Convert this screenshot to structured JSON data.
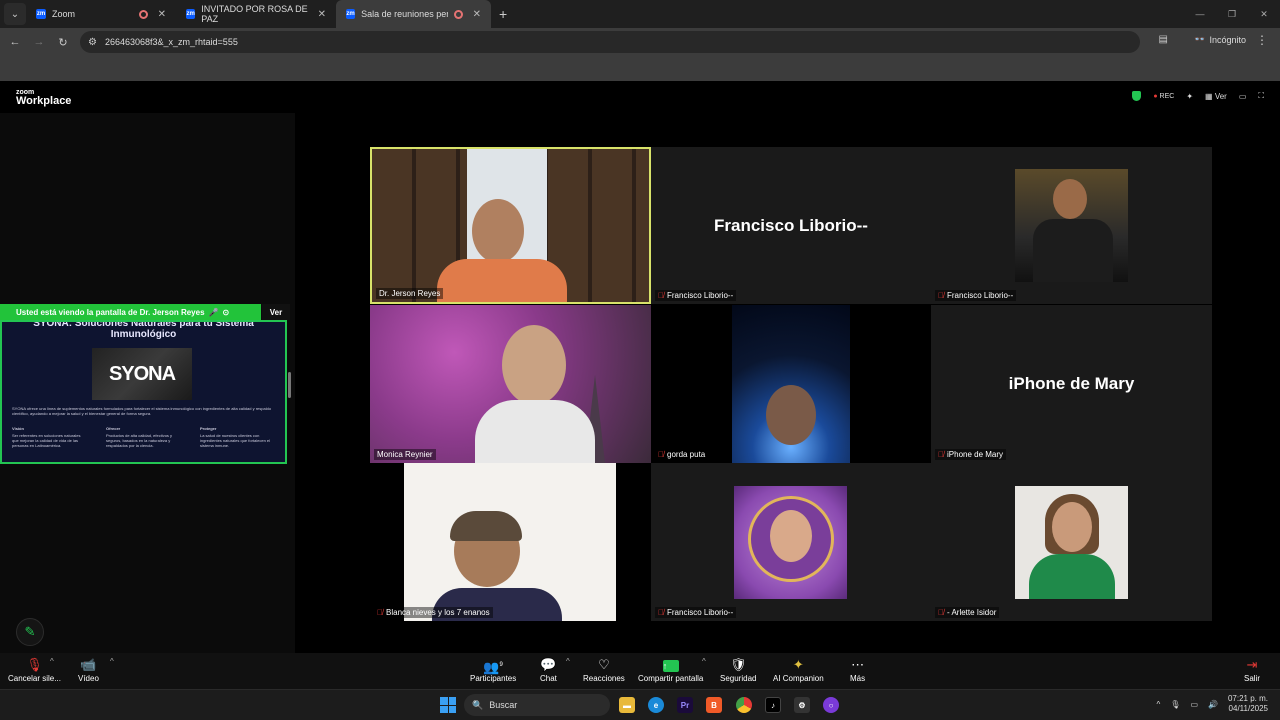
{
  "browser": {
    "tabs": [
      {
        "label": "Zoom",
        "active": false
      },
      {
        "label": "INVITADO POR ROSA DE PAZ",
        "active": false
      },
      {
        "label": "Sala de reuniones personal",
        "active": true
      }
    ],
    "url": "266463068f3&_x_zm_rhtaid=555",
    "incognito_label": "Incógnito"
  },
  "zoom": {
    "logo_small": "zoom",
    "logo_big": "Workplace",
    "rec_label": "REC",
    "view_label": "Ver"
  },
  "share": {
    "banner": "Usted está viendo la pantalla de  Dr. Jerson Reyes",
    "view_button": "Ver",
    "slide_title": "SYONA: Soluciones Naturales para tu Sistema Inmunológico",
    "slide_logo": "SYONA",
    "slide_body": "SYONA ofrece una línea de suplementos naturales formulados para fortalecer el sistema inmunológico con ingredientes de alta calidad y respaldo científico, ayudando a mejorar la salud y el bienestar general de forma segura.",
    "slide_cols": [
      {
        "head": "Visión",
        "text": "Ser referentes en soluciones naturales que mejoran la calidad de vida de las personas en Latinoamérica."
      },
      {
        "head": "Ofrecer",
        "text": "Productos de alta calidad, efectivos y seguros, basados en la naturaleza y respaldados por la ciencia."
      },
      {
        "head": "Proteger",
        "text": "La salud de nuestros clientes con ingredientes naturales que fortalecen el sistema inmune."
      }
    ]
  },
  "participants": [
    {
      "name": "Dr. Jerson Reyes",
      "muted": false,
      "type": "video",
      "speaking": true
    },
    {
      "name": "Francisco Liborio--",
      "muted": true,
      "type": "name",
      "display": "Francisco Liborio--"
    },
    {
      "name": "Francisco Liborio--",
      "muted": true,
      "type": "photo"
    },
    {
      "name": "Monica Reynier",
      "muted": false,
      "type": "video"
    },
    {
      "name": "gorda puta",
      "muted": true,
      "type": "video"
    },
    {
      "name": "iPhone de Mary",
      "muted": true,
      "type": "name",
      "display": "iPhone de Mary"
    },
    {
      "name": "Blanca nieves y los 7 enanos",
      "muted": true,
      "type": "video"
    },
    {
      "name": "Francisco Liborio--",
      "muted": true,
      "type": "photo"
    },
    {
      "name": "- Arlette Isidor",
      "muted": true,
      "type": "photo"
    }
  ],
  "toolbar": {
    "mic": "Cancelar sile...",
    "video": "Vídeo",
    "participants": "Participantes",
    "participants_count": "9",
    "chat": "Chat",
    "reactions": "Reacciones",
    "share": "Compartir pantalla",
    "security": "Seguridad",
    "ai": "AI Companion",
    "more": "Más",
    "leave": "Salir"
  },
  "taskbar": {
    "search": "Buscar",
    "time": "07:21 p. m.",
    "date": "04/11/2025"
  },
  "colors": {
    "accent_green": "#23c552",
    "speaker_border": "#d8e36a",
    "zoom_blue": "#0b5cff",
    "mute_red": "#e53935"
  }
}
